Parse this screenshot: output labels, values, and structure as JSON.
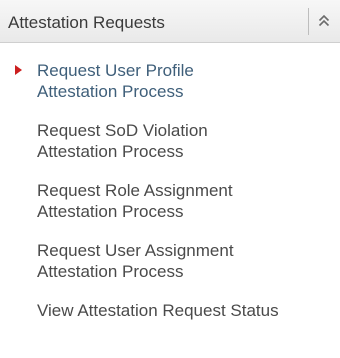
{
  "panel": {
    "title": "Attestation Requests",
    "collapse_icon": "double-chevron-up-icon",
    "colors": {
      "active_marker": "#cc1f1f",
      "active_text": "#3f5f7a",
      "text": "#4a4a4a"
    }
  },
  "menu": {
    "items": [
      {
        "label": "Request User Profile\nAttestation Process",
        "active": true
      },
      {
        "label": "Request SoD Violation\nAttestation Process",
        "active": false
      },
      {
        "label": "Request Role Assignment\nAttestation Process",
        "active": false
      },
      {
        "label": "Request User Assignment\nAttestation Process",
        "active": false
      },
      {
        "label": "View Attestation Request Status",
        "active": false
      }
    ]
  }
}
